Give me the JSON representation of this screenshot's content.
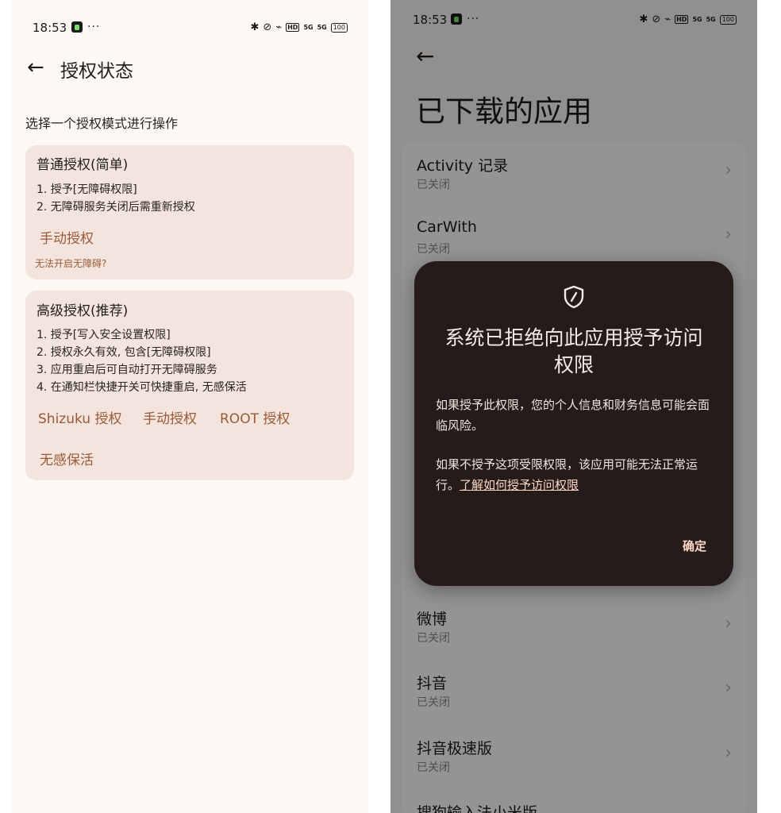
{
  "left": {
    "statusbar": {
      "time": "18:53",
      "dots": "···",
      "hd": "HD",
      "sig1": "5G",
      "sig2": "5G",
      "battery": "100"
    },
    "header": {
      "back_icon": "←",
      "title": "授权状态"
    },
    "hint": "选择一个授权模式进行操作",
    "basic_card": {
      "title": "普通授权(简单)",
      "lines": [
        "1. 授予[无障碍权限]",
        "2. 无障碍服务关闭后需重新授权"
      ],
      "manual_button": "手动授权",
      "help_link": "无法开启无障碍?"
    },
    "advanced_card": {
      "title": "高级授权(推荐)",
      "lines": [
        "1. 授予[写入安全设置权限]",
        "2. 授权永久有效, 包含[无障碍权限]",
        "3. 应用重启后可自动打开无障碍服务",
        "4. 在通知栏快捷开关可快捷重启, 无感保活"
      ],
      "shizuku_button": "Shizuku 授权",
      "manual_button": "手动授权",
      "root_button": "ROOT 授权",
      "keepalive_button": "无感保活"
    }
  },
  "right": {
    "statusbar": {
      "time": "18:53",
      "dots": "···",
      "hd": "HD",
      "sig1": "5G",
      "sig2": "5G",
      "battery": "100"
    },
    "header": {
      "back_icon": "←",
      "title": "已下载的应用"
    },
    "apps": [
      {
        "name": "Activity 记录",
        "status": "已关闭"
      },
      {
        "name": "CarWith",
        "status": "已关闭"
      },
      {
        "name": "微博",
        "status": "已关闭"
      },
      {
        "name": "抖音",
        "status": "已关闭"
      },
      {
        "name": "抖音极速版",
        "status": "已关闭"
      },
      {
        "name": "搜狗输入法小米版",
        "status": ""
      }
    ],
    "dialog": {
      "icon": "shield-icon",
      "title": "系统已拒绝向此应用授予访问权限",
      "body1": "如果授予此权限，您的个人信息和财务信息可能会面临风险。",
      "body2_prefix": "如果不授予这项受限权限，该应用可能无法正常运行。",
      "body2_link": "了解如何授予访问权限",
      "ok_button": "确定"
    }
  }
}
